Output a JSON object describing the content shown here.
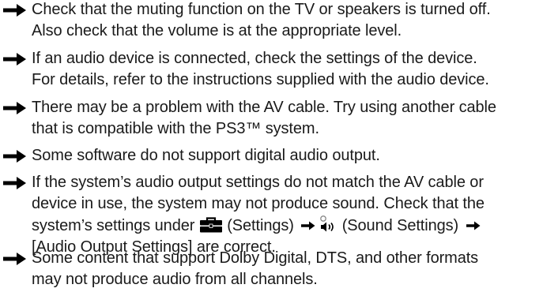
{
  "items": [
    {
      "lines": [
        "Check that the muting function on the TV or speakers is turned off.",
        "Also check that the volume is at the appropriate level."
      ]
    },
    {
      "lines": [
        "If an audio device is connected, check the settings of the device.",
        "For details, refer to the instructions supplied with the audio device."
      ]
    },
    {
      "lines": [
        "There may be a problem with the AV cable. Try using another cable",
        "that is compatible with the PS3™ system."
      ]
    },
    {
      "lines": [
        "Some software do not support digital audio output."
      ]
    },
    {
      "lines": [
        "If the system’s audio output settings do not match the AV cable or",
        "device in use, the system may not produce sound. Check that the"
      ],
      "line3_prefix": "system’s settings under ",
      "settings_label": " (Settings) ",
      "sound_settings_label": " (Sound Settings) ",
      "line4": "[Audio Output Settings] are correct."
    },
    {
      "lines": [
        "Some content that support Dolby Digital, DTS, and other formats",
        "may not produce audio from all channels."
      ]
    }
  ],
  "icons": {
    "bullet": "right-arrow-icon",
    "settings": "toolbox-icon",
    "sound": "speaker-icon",
    "separator": "small-right-arrow-icon"
  },
  "colors": {
    "text": "#1a1a1a",
    "arrow": "#000000"
  }
}
